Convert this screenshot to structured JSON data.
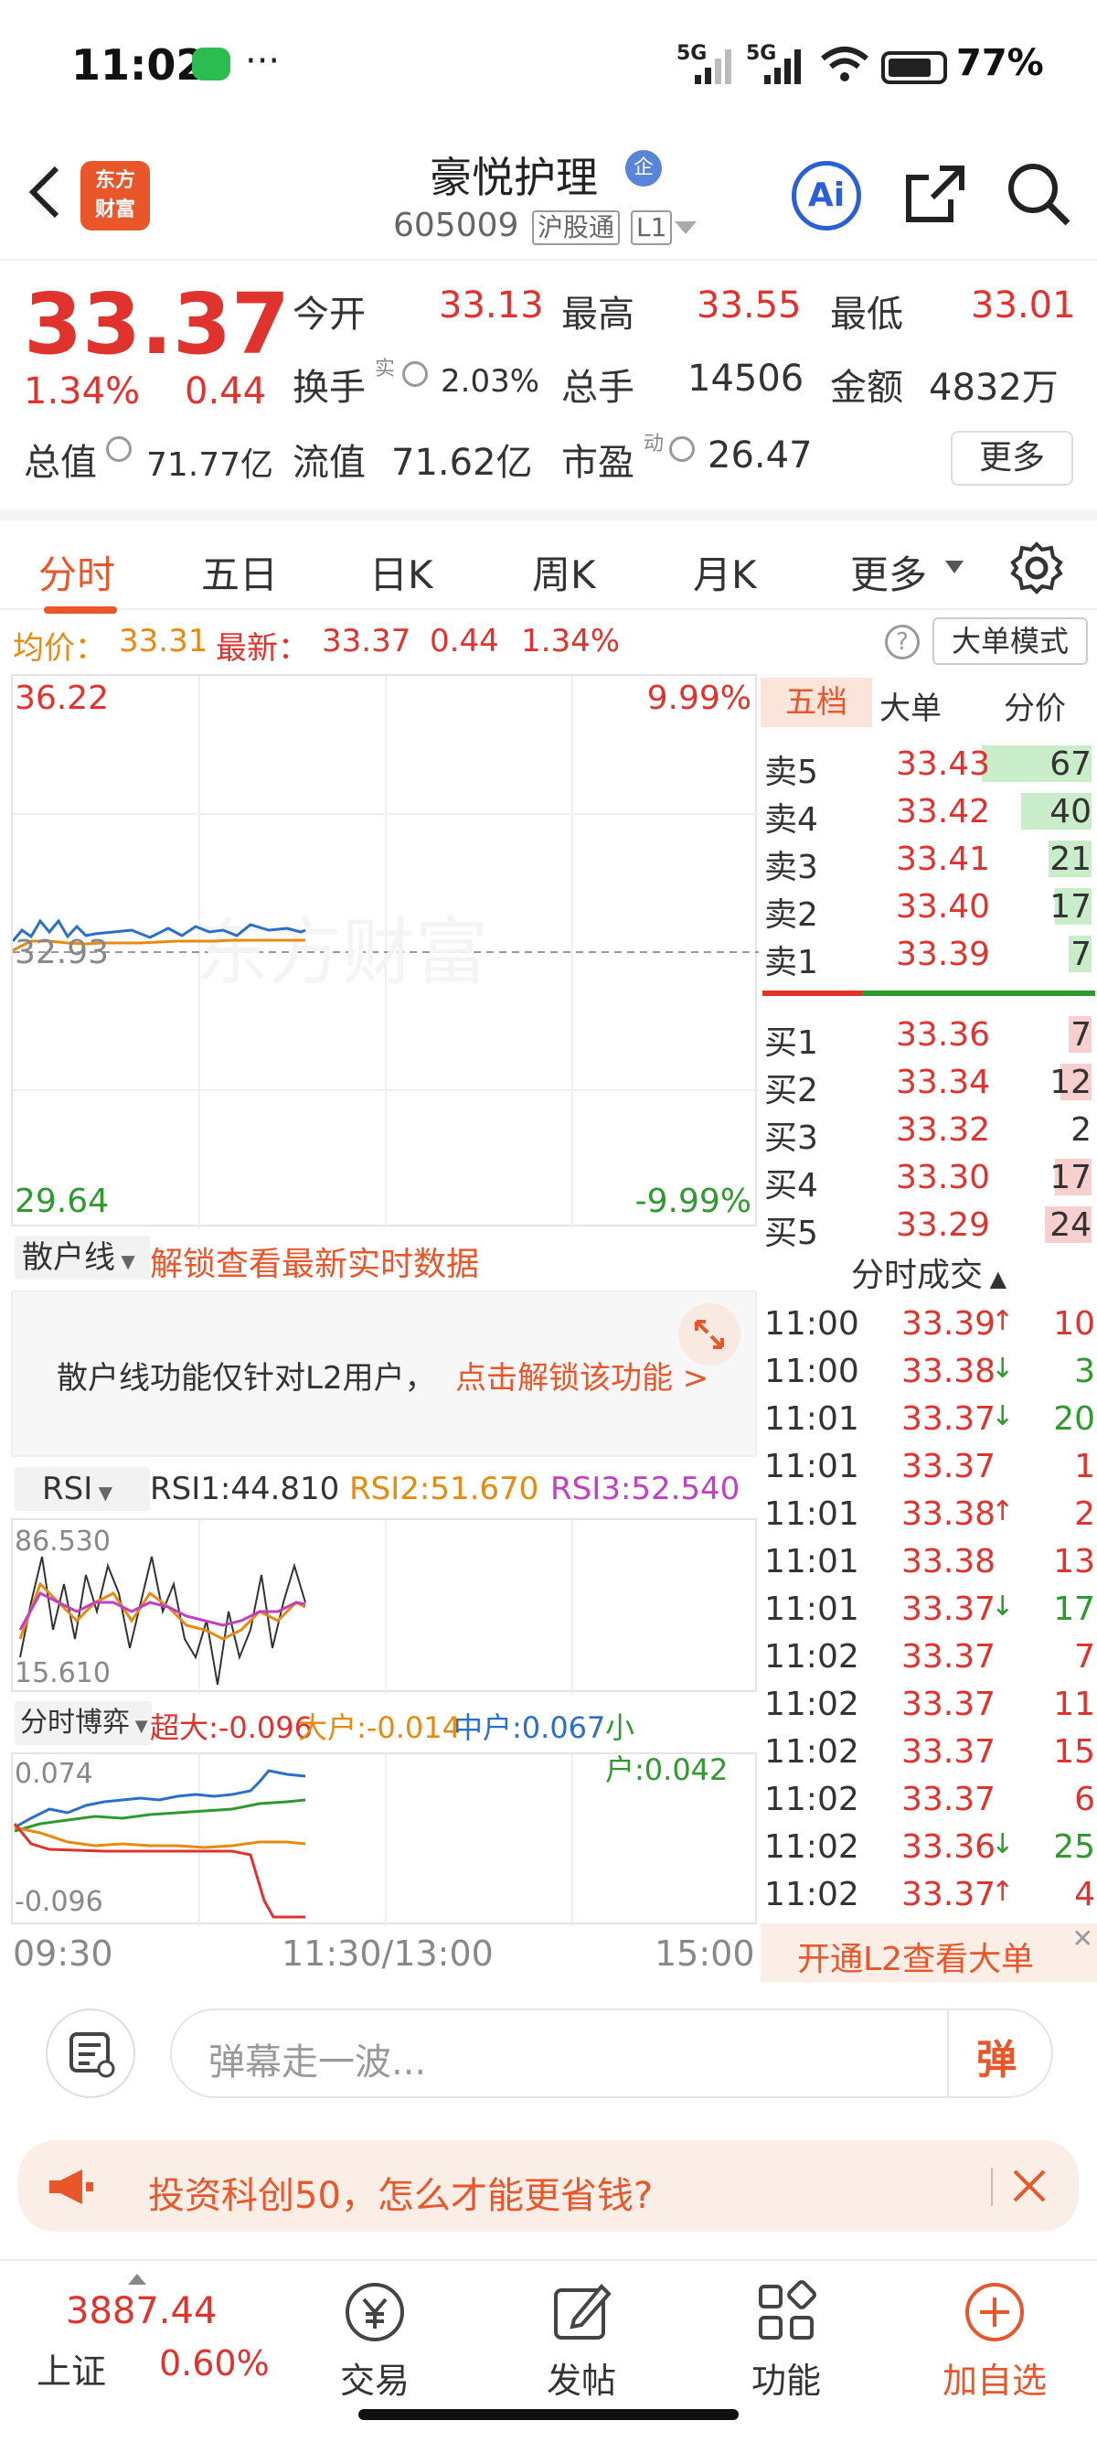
{
  "status_bar": {
    "time": "11:02",
    "more": "···",
    "net1": "5G",
    "net2": "5G",
    "battery": "77%"
  },
  "header": {
    "logo_line1": "东方",
    "logo_line2": "财富",
    "name": "豪悦护理",
    "badge": "企",
    "code": "605009",
    "tag1": "沪股通",
    "tag2": "L1",
    "ai_label": "Ai"
  },
  "quote": {
    "price": "33.37",
    "change_pct": "1.34%",
    "change": "0.44",
    "open_label": "今开",
    "open": "33.13",
    "high_label": "最高",
    "high": "33.55",
    "low_label": "最低",
    "low": "33.01",
    "turnover_label": "换手",
    "turnover_sup": "实",
    "turnover": "2.03%",
    "volume_label": "总手",
    "volume": "14506",
    "amount_label": "金额",
    "amount": "4832万",
    "mktcap_label": "总值",
    "mktcap": "71.77亿",
    "float_label": "流值",
    "float": "71.62亿",
    "pe_label": "市盈",
    "pe_sup": "动",
    "pe": "26.47",
    "more": "更多"
  },
  "tabs": [
    "分时",
    "五日",
    "日K",
    "周K",
    "月K",
    "更多"
  ],
  "avg_bar": {
    "avg_label": "均价：",
    "avg": "33.31",
    "latest_label": "最新：",
    "latest": "33.37",
    "chg": "0.44",
    "pct": "1.34%",
    "help": "?",
    "big_mode": "大单模式"
  },
  "main_chart": {
    "top_price": "36.22",
    "top_pct": "9.99%",
    "mid_price": "32.93",
    "bottom_price": "29.64",
    "bottom_pct": "-9.99%",
    "watermark": "东方财富"
  },
  "retail_panel": {
    "selector": "散户线",
    "unlock_link": "解锁查看最新实时数据",
    "notice": "散户线功能仅针对L2用户，",
    "notice_link": "点击解锁该功能 >"
  },
  "rsi": {
    "selector": "RSI",
    "rsi1": "RSI1:44.810",
    "rsi2": "RSI2:51.670",
    "rsi3": "RSI3:52.540",
    "max": "86.530",
    "min": "15.610"
  },
  "game": {
    "selector": "分时博弈",
    "super": "超大:-0.096",
    "large": "大户:-0.014",
    "mid": "中户:0.067",
    "small": "小户:0.042",
    "max": "0.074",
    "min": "-0.096"
  },
  "time_axis": [
    "09:30",
    "11:30/13:00",
    "15:00"
  ],
  "order_book": {
    "tabs": [
      "五档",
      "大单",
      "分价"
    ],
    "asks": [
      {
        "label": "卖5",
        "price": "33.43",
        "vol": "67",
        "w": 1.0
      },
      {
        "label": "卖4",
        "price": "33.42",
        "vol": "40",
        "w": 0.6
      },
      {
        "label": "卖3",
        "price": "33.41",
        "vol": "21",
        "w": 0.32
      },
      {
        "label": "卖2",
        "price": "33.40",
        "vol": "17",
        "w": 0.26
      },
      {
        "label": "卖1",
        "price": "33.39",
        "vol": "7",
        "w": 0.12
      }
    ],
    "bids": [
      {
        "label": "买1",
        "price": "33.36",
        "vol": "7",
        "w": 0.12
      },
      {
        "label": "买2",
        "price": "33.34",
        "vol": "12",
        "w": 0.2
      },
      {
        "label": "买3",
        "price": "33.32",
        "vol": "2",
        "w": 0.0
      },
      {
        "label": "买4",
        "price": "33.30",
        "vol": "17",
        "w": 0.26
      },
      {
        "label": "买5",
        "price": "33.29",
        "vol": "24",
        "w": 0.36
      }
    ]
  },
  "trades": {
    "title": "分时成交",
    "rows": [
      {
        "time": "11:00",
        "price": "33.39",
        "dir": "up",
        "vol": "10"
      },
      {
        "time": "11:00",
        "price": "33.38",
        "dir": "down",
        "vol": "3"
      },
      {
        "time": "11:01",
        "price": "33.37",
        "dir": "down",
        "vol": "20"
      },
      {
        "time": "11:01",
        "price": "33.37",
        "dir": "",
        "vol": "1"
      },
      {
        "time": "11:01",
        "price": "33.38",
        "dir": "up",
        "vol": "2"
      },
      {
        "time": "11:01",
        "price": "33.38",
        "dir": "",
        "vol": "13"
      },
      {
        "time": "11:01",
        "price": "33.37",
        "dir": "down",
        "vol": "17"
      },
      {
        "time": "11:02",
        "price": "33.37",
        "dir": "",
        "vol": "7"
      },
      {
        "time": "11:02",
        "price": "33.37",
        "dir": "",
        "vol": "11"
      },
      {
        "time": "11:02",
        "price": "33.37",
        "dir": "",
        "vol": "15"
      },
      {
        "time": "11:02",
        "price": "33.37",
        "dir": "",
        "vol": "6"
      },
      {
        "time": "11:02",
        "price": "33.36",
        "dir": "down",
        "vol": "25"
      },
      {
        "time": "11:02",
        "price": "33.37",
        "dir": "up",
        "vol": "4"
      }
    ],
    "l2_banner": "开通L2查看大单"
  },
  "danmu": {
    "placeholder": "弹幕走一波...",
    "send": "弹"
  },
  "banner": {
    "text": "投资科创50，怎么才能更省钱?"
  },
  "navbar": {
    "index_value": "3887.44",
    "index_name": "上证",
    "index_pct": "0.60%",
    "items": [
      "交易",
      "发帖",
      "功能",
      "加自选"
    ]
  }
}
